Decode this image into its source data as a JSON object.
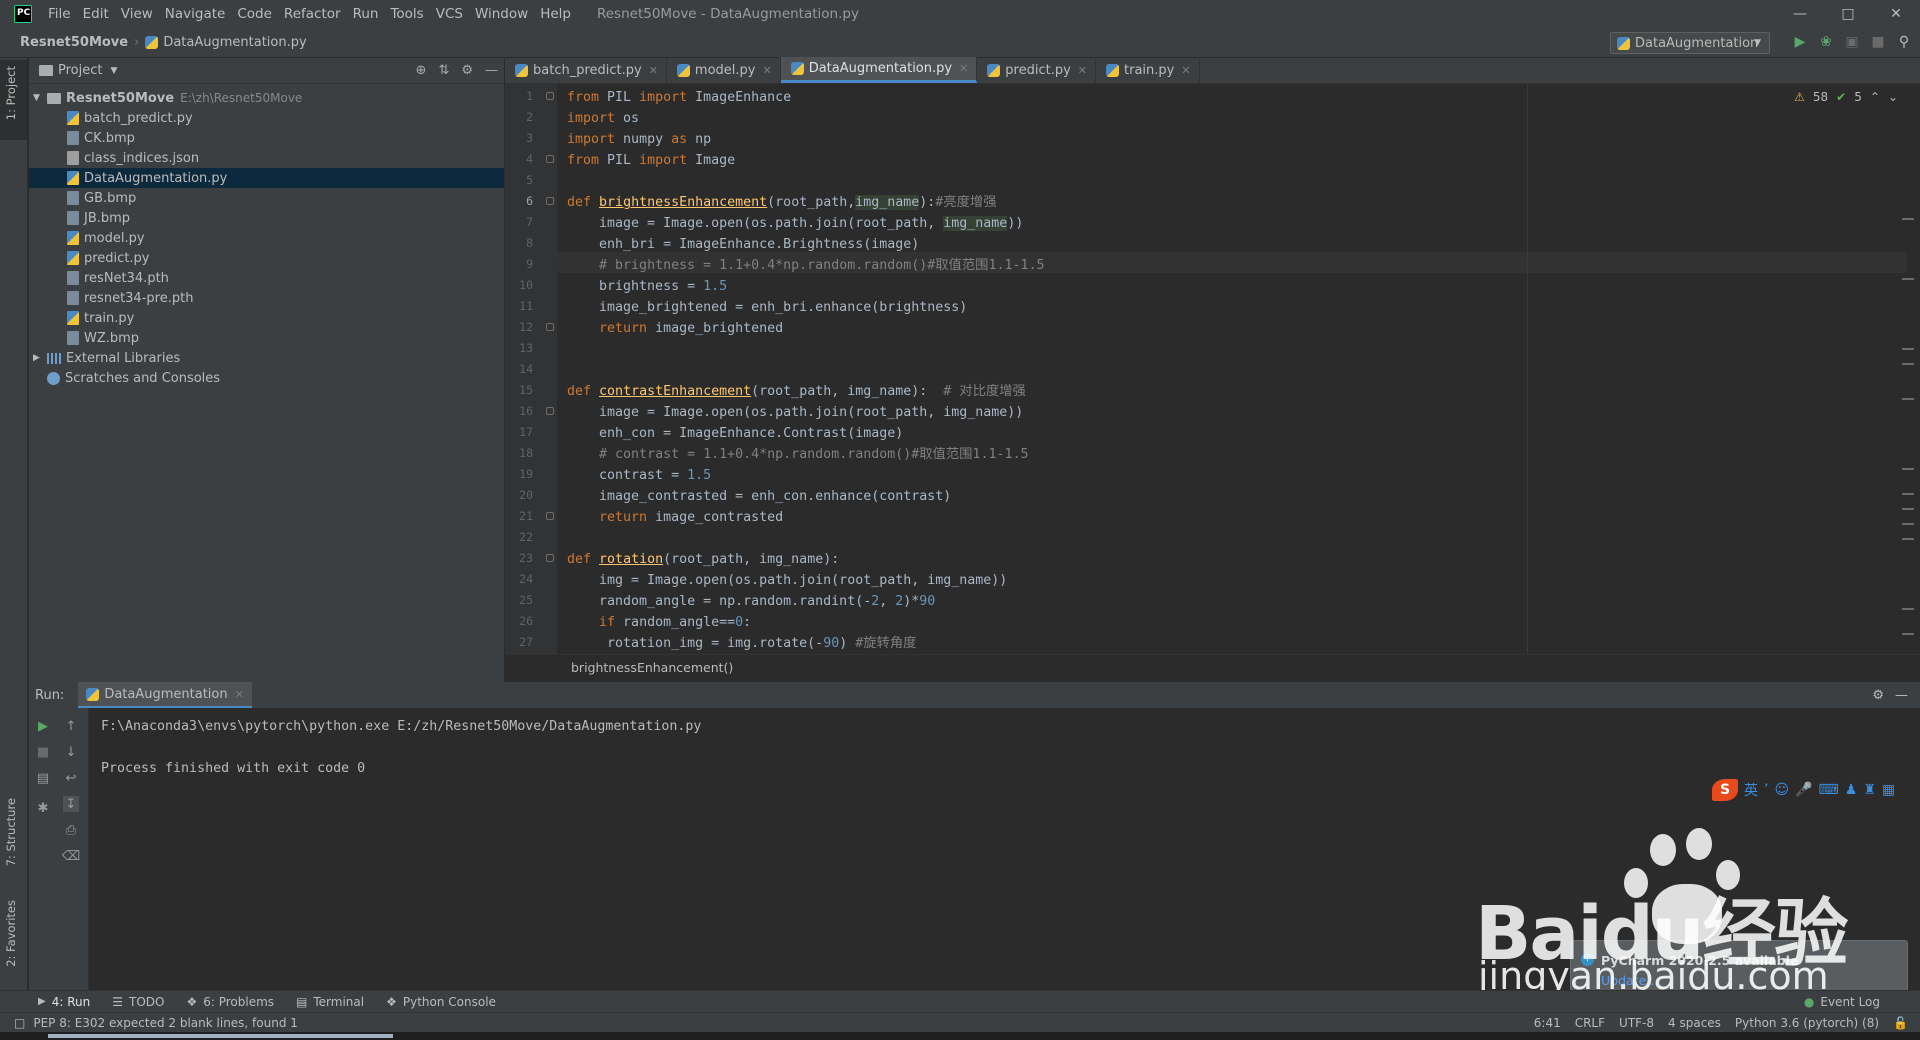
{
  "window": {
    "title": "Resnet50Move - DataAugmentation.py",
    "menu": [
      "File",
      "Edit",
      "View",
      "Navigate",
      "Code",
      "Refactor",
      "Run",
      "Tools",
      "VCS",
      "Window",
      "Help"
    ]
  },
  "navbar": {
    "project": "Resnet50Move",
    "file": "DataAugmentation.py",
    "run_config": "DataAugmentation"
  },
  "left_strip": {
    "project_tab": "1: Project",
    "structure_tab": "7: Structure",
    "favorites_tab": "2: Favorites"
  },
  "project_panel": {
    "title": "Project",
    "root": {
      "name": "Resnet50Move",
      "path": "E:\\zh\\Resnet50Move"
    },
    "files": [
      {
        "name": "batch_predict.py",
        "type": "py"
      },
      {
        "name": "CK.bmp",
        "type": "img"
      },
      {
        "name": "class_indices.json",
        "type": "json"
      },
      {
        "name": "DataAugmentation.py",
        "type": "py"
      },
      {
        "name": "GB.bmp",
        "type": "img"
      },
      {
        "name": "JB.bmp",
        "type": "img"
      },
      {
        "name": "model.py",
        "type": "py"
      },
      {
        "name": "predict.py",
        "type": "py"
      },
      {
        "name": "resNet34.pth",
        "type": "pth"
      },
      {
        "name": "resnet34-pre.pth",
        "type": "pth"
      },
      {
        "name": "train.py",
        "type": "py"
      },
      {
        "name": "WZ.bmp",
        "type": "img"
      }
    ],
    "external": "External Libraries",
    "scratches": "Scratches and Consoles"
  },
  "editor": {
    "tabs": [
      "batch_predict.py",
      "model.py",
      "DataAugmentation.py",
      "predict.py",
      "train.py"
    ],
    "active_tab": "DataAugmentation.py",
    "warnings": "58",
    "ok": "5",
    "breadcrumb": "brightnessEnhancement()",
    "line_numbers": [
      "1",
      "2",
      "3",
      "4",
      "5",
      "6",
      "7",
      "8",
      "9",
      "10",
      "11",
      "12",
      "13",
      "14",
      "15",
      "16",
      "17",
      "18",
      "19",
      "20",
      "21",
      "22",
      "23",
      "24",
      "25",
      "26",
      "27"
    ]
  },
  "run_panel": {
    "label": "Run:",
    "tab": "DataAugmentation",
    "output": [
      "F:\\Anaconda3\\envs\\pytorch\\python.exe E:/zh/Resnet50Move/DataAugmentation.py",
      "",
      "Process finished with exit code 0"
    ]
  },
  "bottom_tabs": [
    "4: Run",
    "TODO",
    "6: Problems",
    "Terminal",
    "Python Console"
  ],
  "status": {
    "message": "PEP 8: E302 expected 2 blank lines, found 1",
    "position": "6:41",
    "line_sep": "CRLF",
    "encoding": "UTF-8",
    "indent": "4 spaces",
    "interpreter": "Python 3.6 (pytorch) (8)"
  },
  "notification": {
    "title": "PyCharm 2020.2.5 available",
    "link": "Update..."
  },
  "event_log": "Event Log",
  "ime": {
    "lang": "英"
  },
  "watermark": {
    "baidu": "Baidu经验",
    "site": "jingyan.baidu.com"
  }
}
